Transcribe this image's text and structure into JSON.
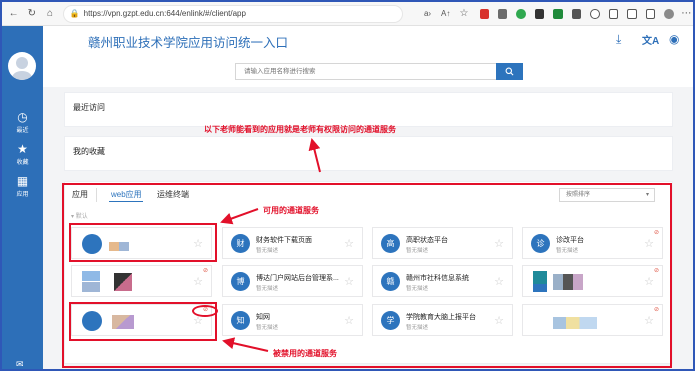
{
  "browser": {
    "url": "https://vpn.gzpt.edu.cn:644/enlink/#/client/app",
    "back_icon": "arrow-left-icon",
    "reload_icon": "reload-icon",
    "home_icon": "home-icon"
  },
  "app": {
    "title": "赣州职业技术学院应用访问统一入口",
    "accent_color": "#2d74bd",
    "sidebar_color": "#2d6fb8"
  },
  "sidebar": {
    "items": [
      {
        "label": "最近",
        "icon": "clock-icon"
      },
      {
        "label": "收藏",
        "icon": "star-icon"
      },
      {
        "label": "应用",
        "icon": "grid-icon"
      }
    ]
  },
  "search": {
    "placeholder": "请输入应用名称进行搜索",
    "button_icon": "search-icon"
  },
  "sections": {
    "recent": "最近访问",
    "favorites": "我的收藏"
  },
  "tabs": {
    "apps": "应用",
    "web": "web应用",
    "ops": "运维终端"
  },
  "sort": {
    "selected": "按照排序"
  },
  "group_label": "默认",
  "tiles": [
    {
      "icon_char": "",
      "name": "",
      "desc": ""
    },
    {
      "icon_char": "财",
      "name": "财务软件下载页面",
      "desc": "暂无描述"
    },
    {
      "icon_char": "高",
      "name": "高职状态平台",
      "desc": "暂无描述"
    },
    {
      "icon_char": "诊",
      "name": "诊改平台",
      "desc": "暂无描述"
    },
    {
      "icon_char": "",
      "name": "",
      "desc": ""
    },
    {
      "icon_char": "博",
      "name": "博达门户网站后台管理系...",
      "desc": "暂无描述"
    },
    {
      "icon_char": "赣",
      "name": "赣州市社科信息系统",
      "desc": "暂无描述"
    },
    {
      "icon_char": "",
      "name": "",
      "desc": ""
    },
    {
      "icon_char": "",
      "name": "",
      "desc": ""
    },
    {
      "icon_char": "知",
      "name": "知网",
      "desc": "暂无描述"
    },
    {
      "icon_char": "学",
      "name": "学院教育大脑上报平台",
      "desc": "暂无描述"
    },
    {
      "icon_char": "",
      "name": "",
      "desc": ""
    }
  ],
  "annotations": {
    "top": "以下老师能看到的应用就是老师有权限访问的通道服务",
    "usable": "可用的通道服务",
    "disabled": "被禁用的通道服务",
    "color": "#e2102a"
  }
}
